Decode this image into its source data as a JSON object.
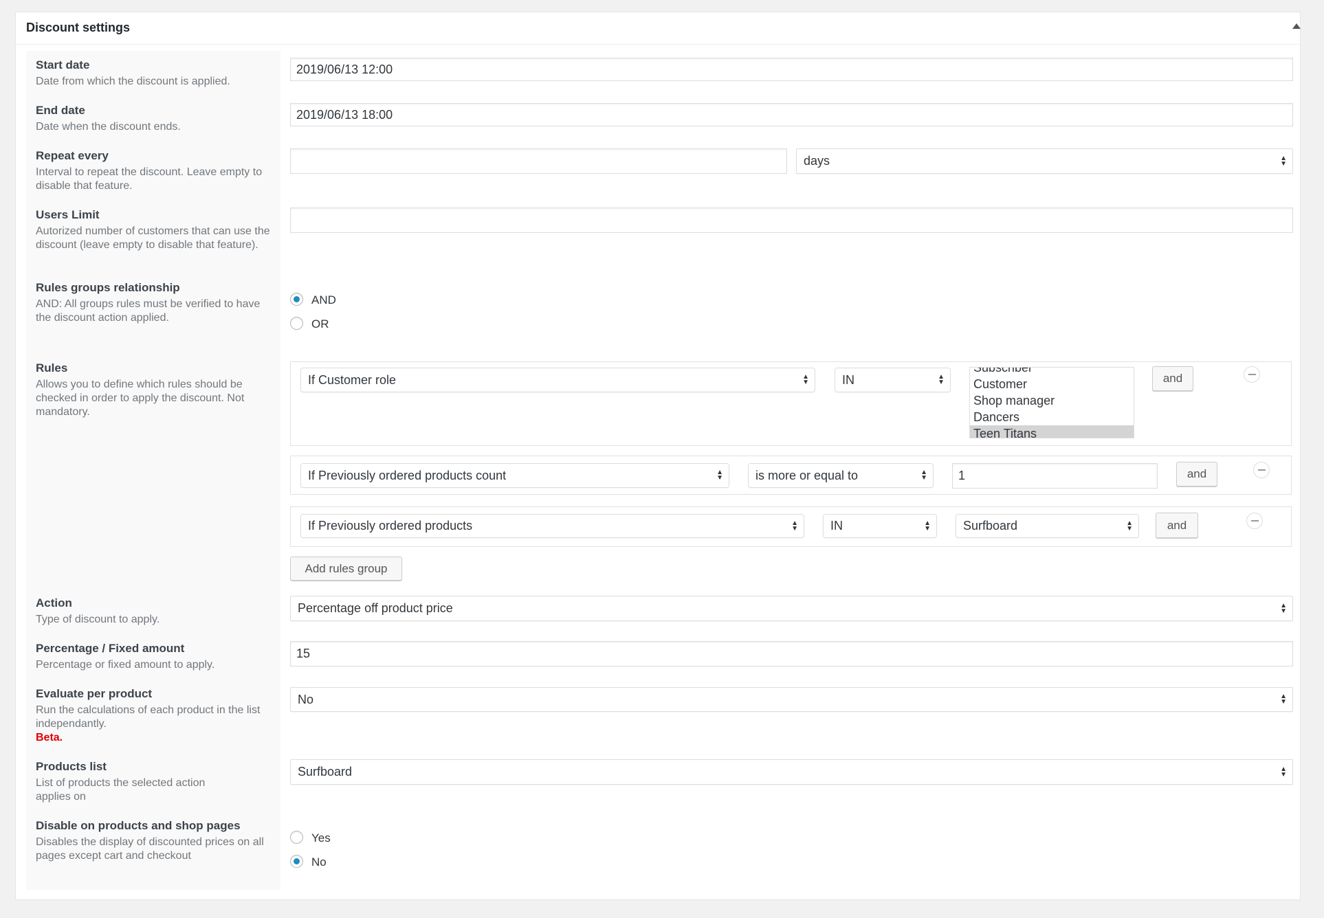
{
  "panel": {
    "title": "Discount settings",
    "toggle_icon": "triangle-up-icon"
  },
  "fields": {
    "start_date": {
      "label": "Start date",
      "desc": "Date from which the discount is applied.",
      "value": "2019/06/13 12:00"
    },
    "end_date": {
      "label": "End date",
      "desc": "Date when the discount ends.",
      "value": "2019/06/13 18:00"
    },
    "repeat": {
      "label": "Repeat every",
      "desc": "Interval to repeat the discount. Leave empty to disable that feature.",
      "value": "",
      "unit": "days"
    },
    "users_limit": {
      "label": "Users Limit",
      "desc": "Autorized number of customers that can use the discount (leave empty to disable that feature).",
      "value": ""
    },
    "relationship": {
      "label": "Rules groups relationship",
      "desc": "AND: All groups rules must be verified to have the discount action applied.",
      "options": [
        "AND",
        "OR"
      ],
      "selected": "AND"
    },
    "rules": {
      "label": "Rules",
      "desc": "Allows you to define which rules should be checked in order to apply the discount. Not mandatory.",
      "groups": [
        {
          "condition": "If Customer role",
          "operator": "IN",
          "values": [
            "Subscriber",
            "Customer",
            "Shop manager",
            "Dancers",
            "Teen Titans"
          ],
          "selected": "Teen Titans",
          "and": "and"
        },
        {
          "condition": "If Previously ordered products count",
          "operator": "is more or equal to",
          "value": "1",
          "and": "and"
        },
        {
          "condition": "If Previously ordered products",
          "operator": "IN",
          "value": "Surfboard",
          "and": "and"
        }
      ],
      "add_group": "Add rules group"
    },
    "action": {
      "label": "Action",
      "desc": "Type of discount to apply.",
      "value": "Percentage off product price"
    },
    "amount": {
      "label": "Percentage / Fixed amount",
      "desc": "Percentage or fixed amount to apply.",
      "value": "15"
    },
    "evaluate": {
      "label": "Evaluate per product",
      "desc": "Run the calculations of each product in the list independantly.",
      "beta": "Beta.",
      "value": "No"
    },
    "products": {
      "label": "Products list",
      "desc": "List of products the selected action applies on",
      "value": "Surfboard"
    },
    "disable": {
      "label": "Disable on products and shop pages",
      "desc": "Disables the display of discounted prices on all pages except cart and checkout",
      "options": [
        "Yes",
        "No"
      ],
      "selected": "No"
    }
  },
  "colors": {
    "radio_checked": "#1e8cbe",
    "beta": "#e00000"
  }
}
